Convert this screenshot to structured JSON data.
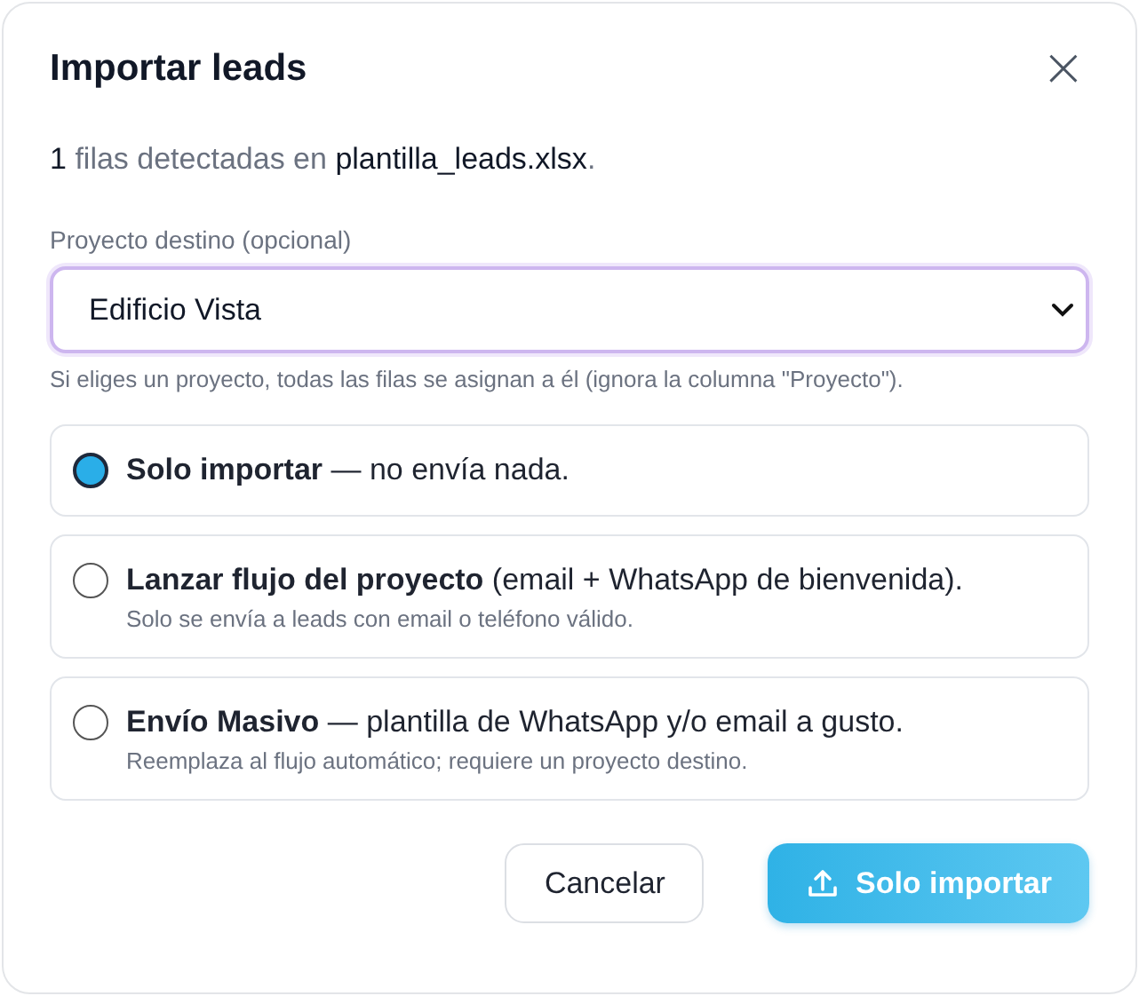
{
  "dialog": {
    "title": "Importar leads",
    "close": "×"
  },
  "summary": "**1** filas detectadas en **plantilla_leads.xlsx**.",
  "project": {
    "label": "Proyecto destino (opcional)",
    "value": "Edificio Vista",
    "hint": "Si eliges un proyecto, todas las filas se asignan a él (ignora la columna \"Proyecto\")."
  },
  "options": [
    {
      "label": "**Solo importar** — no envía nada.",
      "selected": true
    },
    {
      "label": "**Lanzar flujo del proyecto** (email + WhatsApp de bienvenida).",
      "description": "Solo se envía a leads con email o teléfono válido.",
      "selected": false
    },
    {
      "label": "**Envío Masivo** — plantilla de WhatsApp y/o email a gusto.",
      "description": "Reemplaza al flujo automático; requiere un proyecto destino.",
      "selected": false
    }
  ],
  "buttons": [
    {
      "kind": "secondary",
      "label": "Cancelar"
    },
    {
      "kind": "primary",
      "label": "Solo importar"
    }
  ]
}
